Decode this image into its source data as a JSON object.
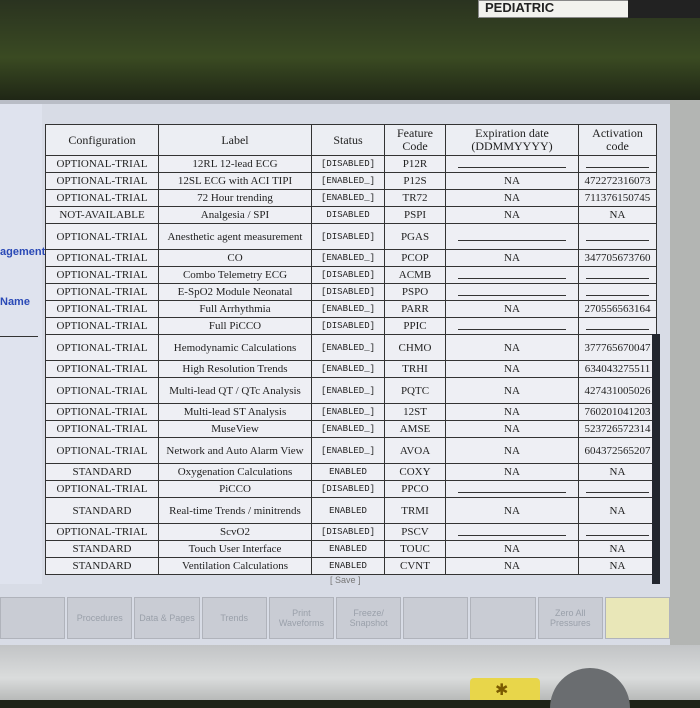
{
  "monitor": {
    "top_label": "PEDIATRIC"
  },
  "left_panel": {
    "item1": "agement",
    "item2": "Name"
  },
  "table": {
    "headers": [
      "Configuration",
      "Label",
      "Status",
      "Feature Code",
      "Expiration date (DDMMYYYY)",
      "Activation code"
    ],
    "rows": [
      {
        "config": "OPTIONAL-TRIAL",
        "label": "12RL 12-lead ECG",
        "status": "[DISABLED]",
        "code": "P12R",
        "expiration": "",
        "activation": ""
      },
      {
        "config": "OPTIONAL-TRIAL",
        "label": "12SL ECG with ACI TIPI",
        "status": "[ENABLED_]",
        "code": "P12S",
        "expiration": "NA",
        "activation": "472272316073"
      },
      {
        "config": "OPTIONAL-TRIAL",
        "label": "72 Hour trending",
        "status": "[ENABLED_]",
        "code": "TR72",
        "expiration": "NA",
        "activation": "711376150745"
      },
      {
        "config": "NOT-AVAILABLE",
        "label": "Analgesia / SPI",
        "status": "DISABLED",
        "code": "PSPI",
        "expiration": "NA",
        "activation": "NA"
      },
      {
        "config": "OPTIONAL-TRIAL",
        "label": "Anesthetic agent measurement",
        "status": "[DISABLED]",
        "code": "PGAS",
        "expiration": "",
        "activation": ""
      },
      {
        "config": "OPTIONAL-TRIAL",
        "label": "CO",
        "status": "[ENABLED_]",
        "code": "PCOP",
        "expiration": "NA",
        "activation": "347705673760"
      },
      {
        "config": "OPTIONAL-TRIAL",
        "label": "Combo Telemetry ECG",
        "status": "[DISABLED]",
        "code": "ACMB",
        "expiration": "",
        "activation": ""
      },
      {
        "config": "OPTIONAL-TRIAL",
        "label": "E-SpO2 Module Neonatal",
        "status": "[DISABLED]",
        "code": "PSPO",
        "expiration": "",
        "activation": ""
      },
      {
        "config": "OPTIONAL-TRIAL",
        "label": "Full Arrhythmia",
        "status": "[ENABLED_]",
        "code": "PARR",
        "expiration": "NA",
        "activation": "270556563164"
      },
      {
        "config": "OPTIONAL-TRIAL",
        "label": "Full PiCCO",
        "status": "[DISABLED]",
        "code": "PPIC",
        "expiration": "",
        "activation": ""
      },
      {
        "config": "OPTIONAL-TRIAL",
        "label": "Hemodynamic Calculations",
        "status": "[ENABLED_]",
        "code": "CHMO",
        "expiration": "NA",
        "activation": "377765670047"
      },
      {
        "config": "OPTIONAL-TRIAL",
        "label": "High Resolution Trends",
        "status": "[ENABLED_]",
        "code": "TRHI",
        "expiration": "NA",
        "activation": "634043275511"
      },
      {
        "config": "OPTIONAL-TRIAL",
        "label": "Multi-lead QT / QTc Analysis",
        "status": "[ENABLED_]",
        "code": "PQTC",
        "expiration": "NA",
        "activation": "427431005026"
      },
      {
        "config": "OPTIONAL-TRIAL",
        "label": "Multi-lead ST Analysis",
        "status": "[ENABLED_]",
        "code": "12ST",
        "expiration": "NA",
        "activation": "760201041203"
      },
      {
        "config": "OPTIONAL-TRIAL",
        "label": "MuseView",
        "status": "[ENABLED_]",
        "code": "AMSE",
        "expiration": "NA",
        "activation": "523726572314"
      },
      {
        "config": "OPTIONAL-TRIAL",
        "label": "Network and Auto Alarm View",
        "status": "[ENABLED_]",
        "code": "AVOA",
        "expiration": "NA",
        "activation": "604372565207"
      },
      {
        "config": "STANDARD",
        "label": "Oxygenation Calculations",
        "status": "ENABLED",
        "code": "COXY",
        "expiration": "NA",
        "activation": "NA"
      },
      {
        "config": "OPTIONAL-TRIAL",
        "label": "PiCCO",
        "status": "[DISABLED]",
        "code": "PPCO",
        "expiration": "",
        "activation": ""
      },
      {
        "config": "STANDARD",
        "label": "Real-time Trends / minitrends",
        "status": "ENABLED",
        "code": "TRMI",
        "expiration": "NA",
        "activation": "NA"
      },
      {
        "config": "OPTIONAL-TRIAL",
        "label": "ScvO2",
        "status": "[DISABLED]",
        "code": "PSCV",
        "expiration": "",
        "activation": ""
      },
      {
        "config": "STANDARD",
        "label": "Touch User Interface",
        "status": "ENABLED",
        "code": "TOUC",
        "expiration": "NA",
        "activation": "NA"
      },
      {
        "config": "STANDARD",
        "label": "Ventilation Calculations",
        "status": "ENABLED",
        "code": "CVNT",
        "expiration": "NA",
        "activation": "NA"
      }
    ]
  },
  "save_label": "[ Save ]",
  "bottom_buttons": [
    "",
    "Procedures",
    "Data & Pages",
    "Trends",
    "Print Waveforms",
    "Freeze/ Snapshot",
    "",
    "",
    "Zero All Pressures",
    ""
  ]
}
